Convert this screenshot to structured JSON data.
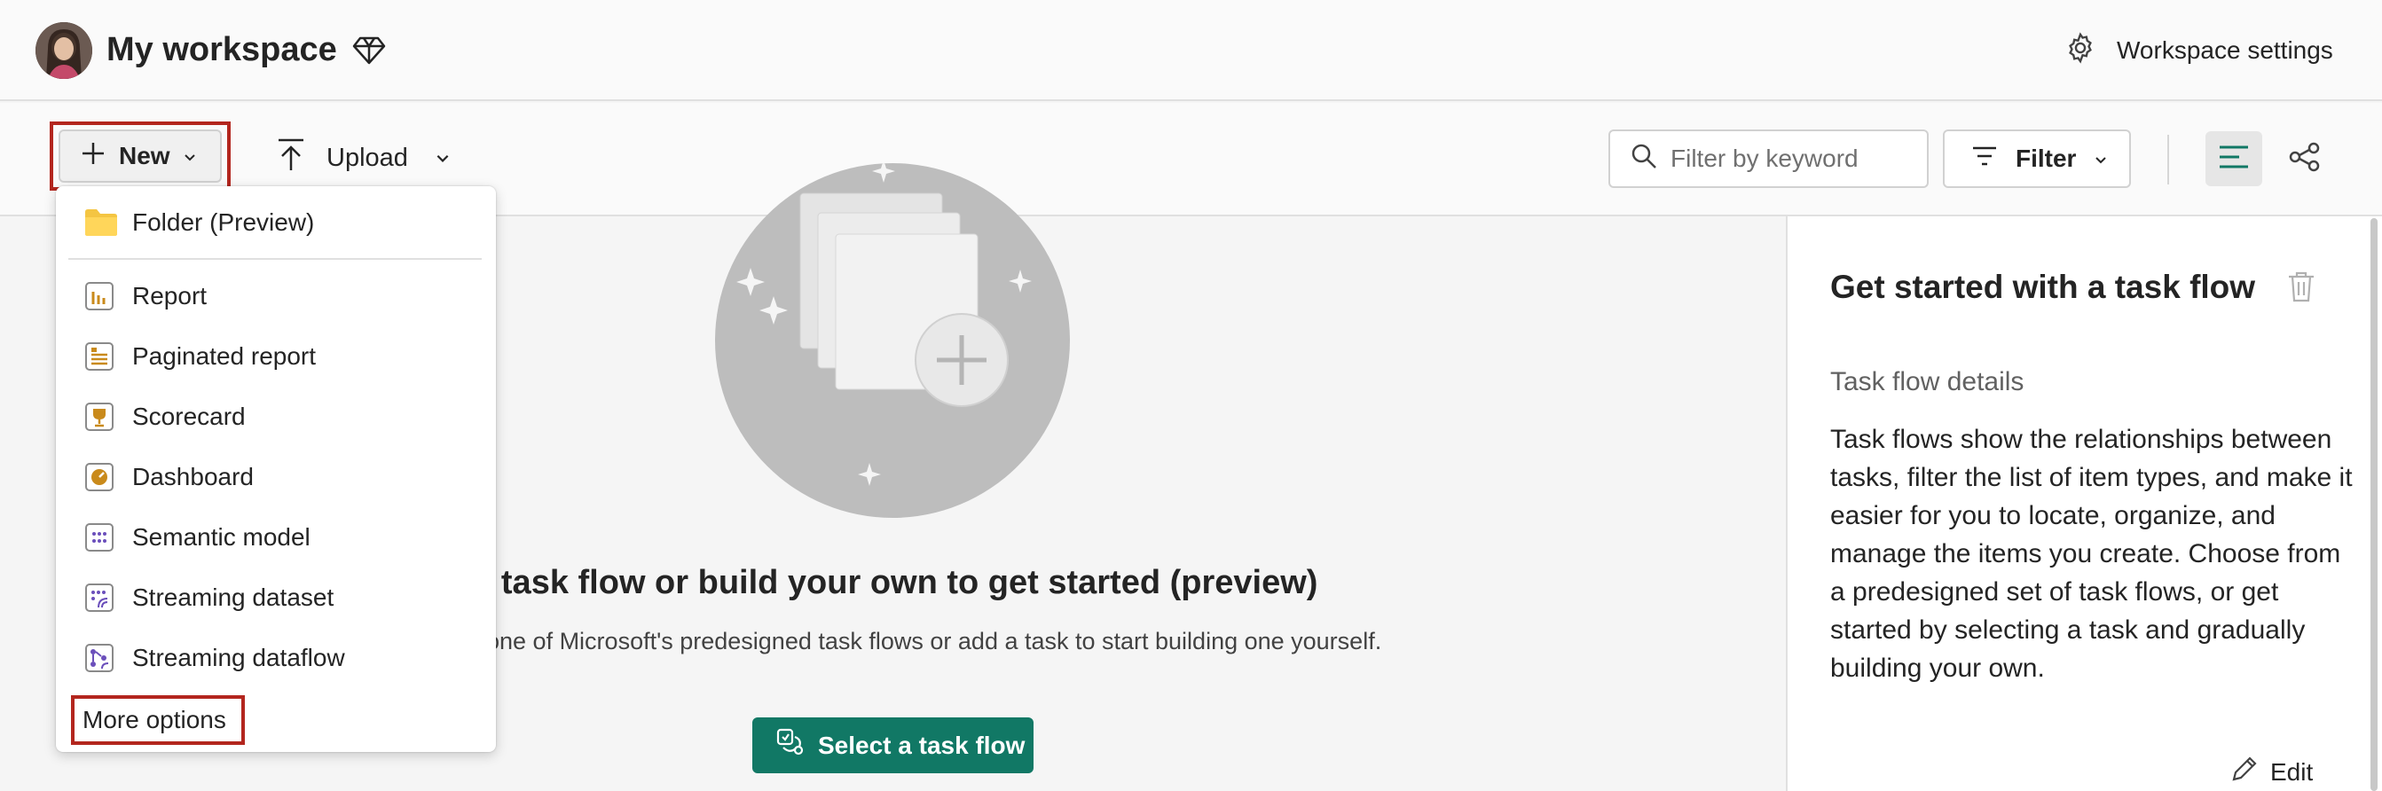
{
  "header": {
    "workspace_title": "My workspace",
    "settings_label": "Workspace settings"
  },
  "toolbar": {
    "new_label": "New",
    "upload_label": "Upload",
    "search_placeholder": "Filter by keyword",
    "filter_label": "Filter"
  },
  "new_menu": {
    "items": [
      {
        "label": "Folder (Preview)",
        "icon": "folder-icon"
      },
      {
        "label": "Report",
        "icon": "report-icon"
      },
      {
        "label": "Paginated report",
        "icon": "paginated-report-icon"
      },
      {
        "label": "Scorecard",
        "icon": "scorecard-icon"
      },
      {
        "label": "Dashboard",
        "icon": "dashboard-icon"
      },
      {
        "label": "Semantic model",
        "icon": "semantic-model-icon"
      },
      {
        "label": "Streaming dataset",
        "icon": "streaming-dataset-icon"
      },
      {
        "label": "Streaming dataflow",
        "icon": "streaming-dataflow-icon"
      }
    ],
    "more_options_label": "More options"
  },
  "main": {
    "heading": "t a task flow or build your own to get started (preview)",
    "subtext": "one of Microsoft's predesigned task flows or add a task to start building one yourself.",
    "select_button_label": "Select a task flow"
  },
  "right_panel": {
    "title": "Get started with a task flow",
    "subtitle": "Task flow details",
    "body": "Task flows show the relationships between tasks, filter the list of item types, and make it easier for you to locate, organize, and manage the items you create. Choose from a predesigned set of task flows, or get started by selecting a task and gradually building your own.",
    "edit_label": "Edit"
  },
  "colors": {
    "accent_green": "#117865",
    "highlight_red": "#b3261e"
  }
}
